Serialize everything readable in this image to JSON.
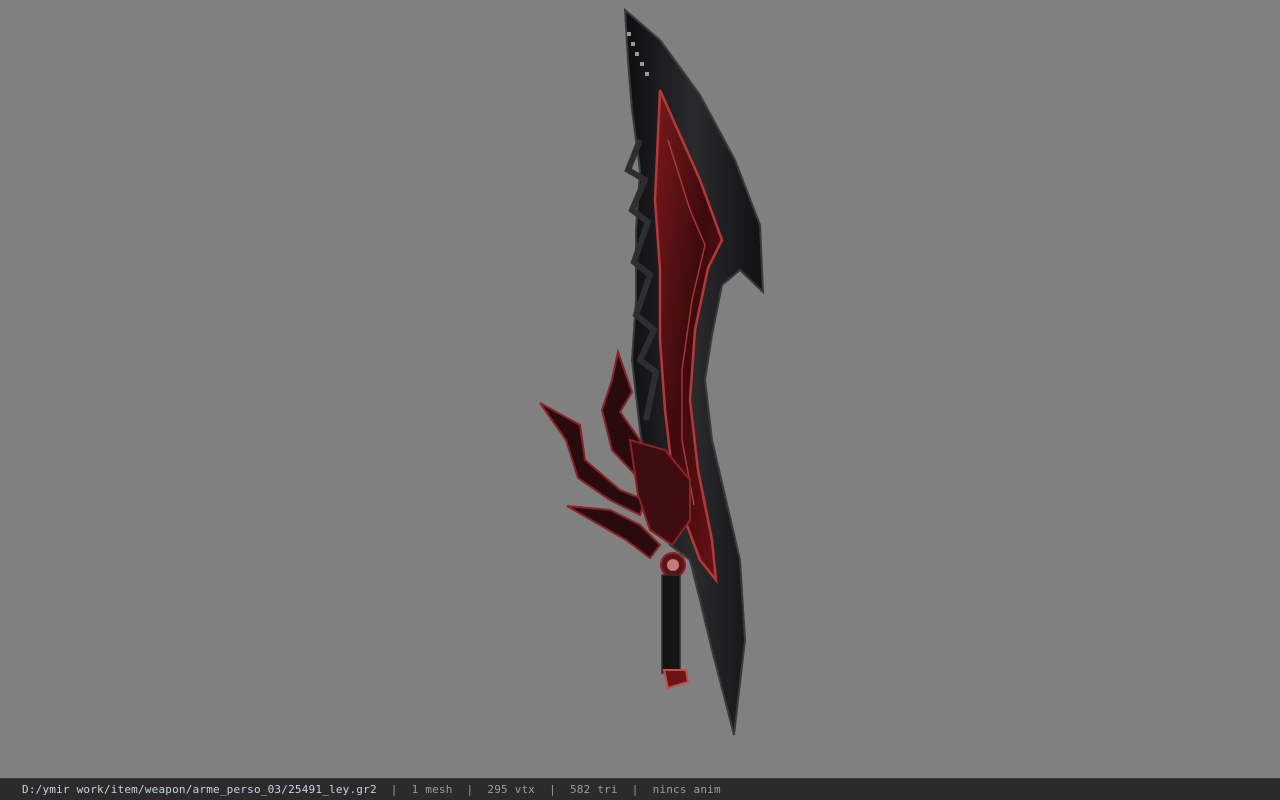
{
  "viewer": {
    "background_color": "#808080",
    "model": {
      "name": "sword-model",
      "colors": {
        "blade": "#1c1c1e",
        "edge": "#3a3a3c",
        "inlay": "#5a0f12",
        "inlay_highlight": "#b23a3a"
      }
    }
  },
  "status_bar": {
    "file_path": "D:/ymir work/item/weapon/arme_perso_03/25491_ley.gr2",
    "separator": "|",
    "mesh_count": "1 mesh",
    "vertex_count": "295 vtx",
    "triangle_count": "582 tri",
    "animation": "nincs anim"
  }
}
